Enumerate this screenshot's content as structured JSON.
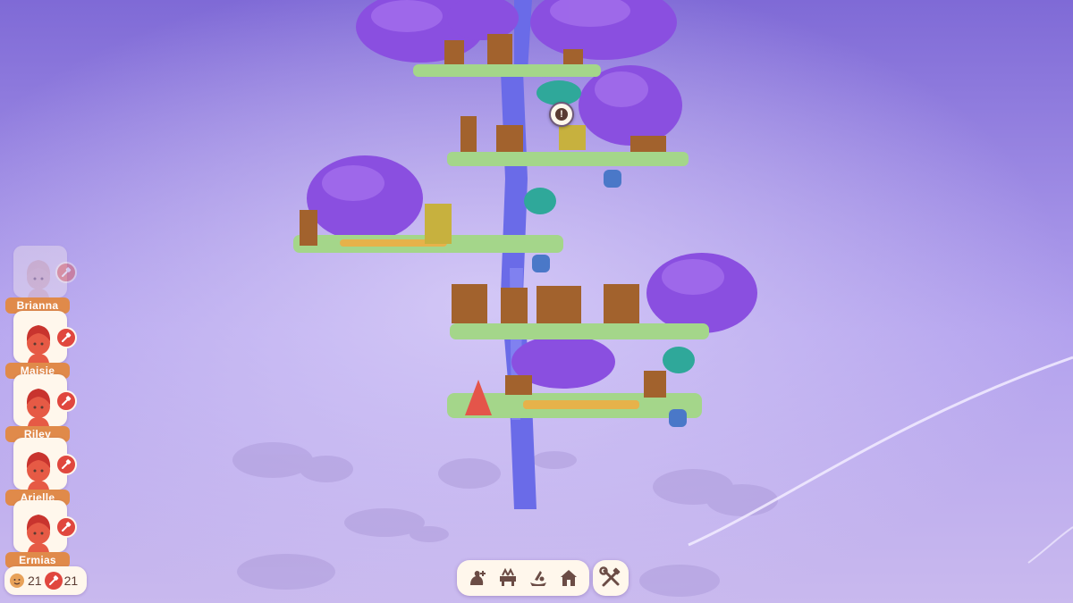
{
  "villagers": [
    {
      "name": "Brianna",
      "hair": "#f2c4a0",
      "skin": "#f5c9a8",
      "task": "builder"
    },
    {
      "name": "Maisie",
      "hair": "#c8342e",
      "skin": "#e65a45",
      "task": "builder"
    },
    {
      "name": "Riley",
      "hair": "#c8342e",
      "skin": "#e65a45",
      "task": "builder"
    },
    {
      "name": "Arielle",
      "hair": "#c8342e",
      "skin": "#e65a45",
      "task": "builder"
    },
    {
      "name": "Ermias",
      "hair": "#c8342e",
      "skin": "#e65a45",
      "task": "builder"
    }
  ],
  "counters": {
    "population": "21",
    "builders": "21"
  },
  "toolbar": {
    "items": [
      "add-villager-icon",
      "crafting-station-icon",
      "gather-icon",
      "home-icon"
    ],
    "tools": "hammer-wrench-icon"
  },
  "colors": {
    "sky_top": "#7f6ad6",
    "sky_bottom": "#c6b8f0",
    "foliage": "#8a4fe0",
    "grass": "#a4d68a",
    "trunk": "#6a6be8",
    "panel": "#fff7ec",
    "name_tag": "#e08a4a",
    "badge": "#e0473e"
  }
}
